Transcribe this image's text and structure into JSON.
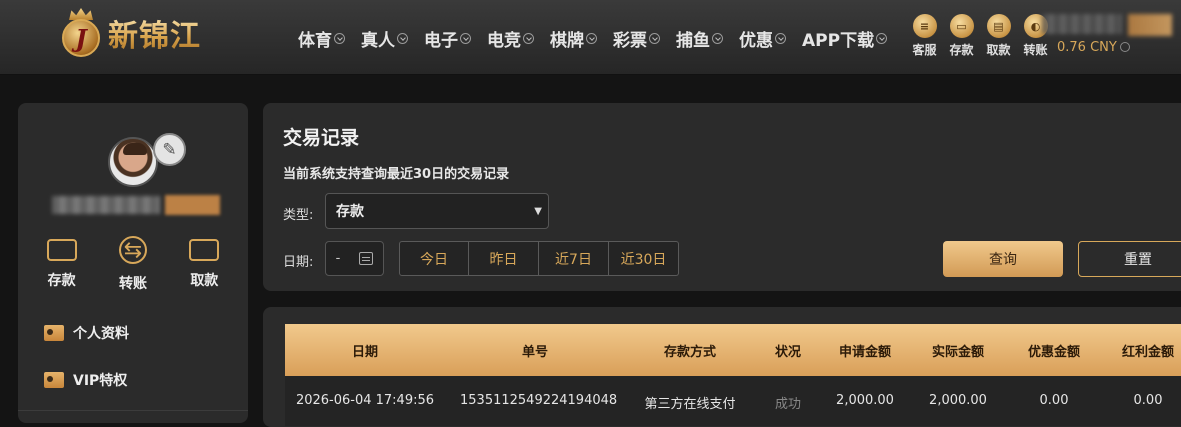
{
  "brand": {
    "name": "新锦江",
    "badge_letter": "J"
  },
  "nav": {
    "items": [
      "体育",
      "真人",
      "电子",
      "电竞",
      "棋牌",
      "彩票",
      "捕鱼",
      "优惠",
      "APP下载"
    ]
  },
  "quick_actions": [
    {
      "label": "客服",
      "glyph": "≡"
    },
    {
      "label": "存款",
      "glyph": "▭"
    },
    {
      "label": "取款",
      "glyph": "▤"
    },
    {
      "label": "转账",
      "glyph": "◐"
    }
  ],
  "account": {
    "balance": "0.76 CNY"
  },
  "sidebar": {
    "actions": [
      {
        "label": "存款",
        "icon": "wallet-icon"
      },
      {
        "label": "转账",
        "icon": "transfer-icon"
      },
      {
        "label": "取款",
        "icon": "card-icon"
      }
    ],
    "menu": [
      {
        "label": "个人资料",
        "icon": "profile-card-icon"
      },
      {
        "label": "VIP特权",
        "icon": "vip-card-icon"
      }
    ]
  },
  "filter": {
    "title": "交易记录",
    "subtitle": "当前系统支持查询最近30日的交易记录",
    "type_label": "类型:",
    "type_value": "存款",
    "date_label": "日期:",
    "date_value": "-",
    "ranges": [
      "今日",
      "昨日",
      "近7日",
      "近30日"
    ],
    "query_label": "查询",
    "reset_label": "重置"
  },
  "table": {
    "columns": [
      "日期",
      "单号",
      "存款方式",
      "状况",
      "申请金额",
      "实际金额",
      "优惠金额",
      "红利金额"
    ],
    "rows": [
      [
        "2026-06-04 17:49:56",
        "1535112549224194048",
        "第三方在线支付",
        "成功",
        "2,000.00",
        "2,000.00",
        "0.00",
        "0.00"
      ]
    ]
  },
  "colors": {
    "accent": "#d8a85a",
    "header_gold": "#e8b36e",
    "panel": "#2b2b2b",
    "background": "#141414"
  }
}
